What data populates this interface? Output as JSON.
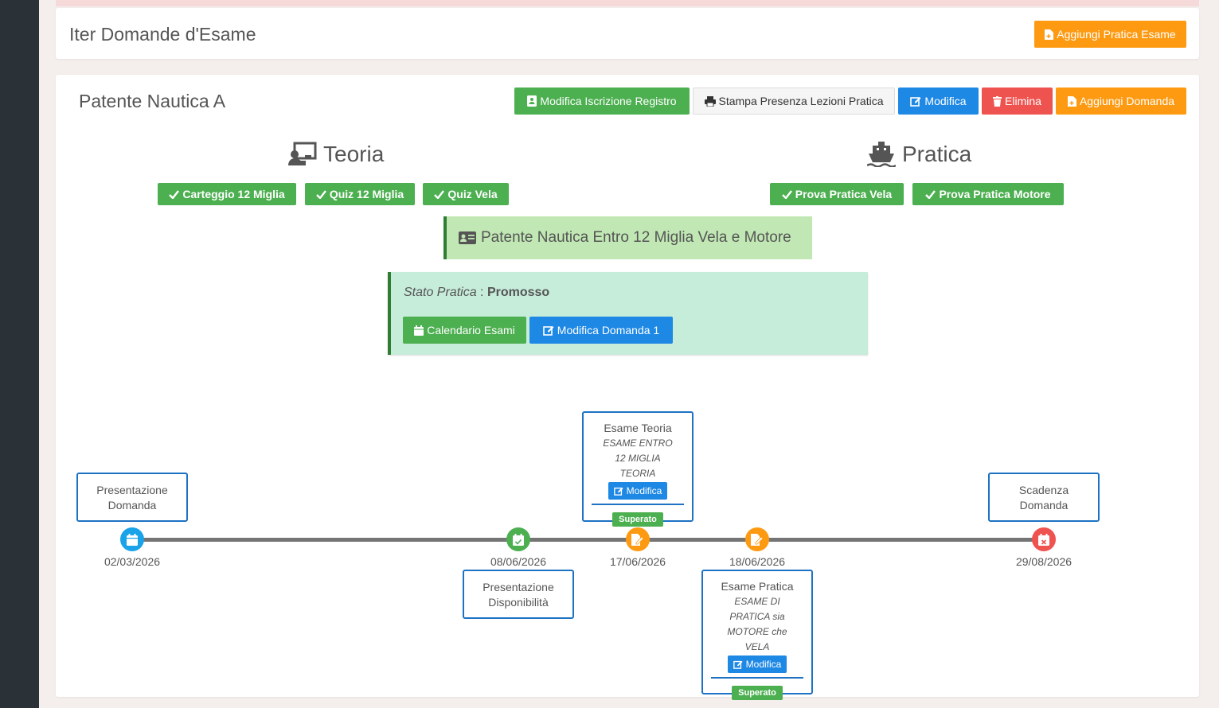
{
  "header": {
    "title": "Iter Domande d'Esame",
    "add_practice_label": "Aggiungi Pratica Esame"
  },
  "main": {
    "title": "Patente Nautica A",
    "buttons": {
      "edit_registration": "Modifica Iscrizione Registro",
      "print_attendance": "Stampa Presenza Lezioni Pratica",
      "edit": "Modifica",
      "delete": "Elimina",
      "add_application": "Aggiungi Domanda"
    },
    "theory": {
      "heading": "Teoria",
      "tags": [
        "Carteggio 12 Miglia",
        "Quiz 12 Miglia",
        "Quiz Vela"
      ]
    },
    "practice": {
      "heading": "Pratica",
      "tags": [
        "Prova Pratica Vela",
        "Prova Pratica Motore"
      ]
    },
    "license": "Patente Nautica Entro 12 Miglia Vela e Motore",
    "status": {
      "label": "Stato Pratica",
      "separator": " : ",
      "value": "Promosso",
      "calendar_button": "Calendario Esami",
      "edit_application_button": "Modifica Domanda 1"
    }
  },
  "timeline": {
    "events": [
      {
        "date": "02/03/2026",
        "label": "Presentazione Domanda",
        "icon": "calendar-icon",
        "color": "#1aa3e8"
      },
      {
        "date": "08/06/2026",
        "label": "Presentazione Disponibilità",
        "icon": "calendar-check-icon",
        "color": "#4caf50"
      },
      {
        "date": "17/06/2026",
        "label": "Esame Teoria",
        "sub": "ESAME ENTRO 12 MIGLIA TEORIA",
        "button": "Modifica",
        "badge": "Superato",
        "icon": "edit-doc-icon",
        "color": "#fd9a12"
      },
      {
        "date": "18/06/2026",
        "label": "Esame Pratica",
        "sub": "ESAME DI PRATICA sia MOTORE che VELA",
        "button": "Modifica",
        "badge": "Superato",
        "icon": "edit-doc-icon",
        "color": "#fd9a12"
      },
      {
        "date": "29/08/2026",
        "label": "Scadenza Domanda",
        "icon": "calendar-x-icon",
        "color": "#ef5350"
      }
    ]
  },
  "colors": {
    "accent_orange": "#fd9a12",
    "accent_green": "#4caf50",
    "accent_blue": "#1e88e5",
    "accent_red": "#ef5350",
    "sidebar": "#2a3237"
  }
}
